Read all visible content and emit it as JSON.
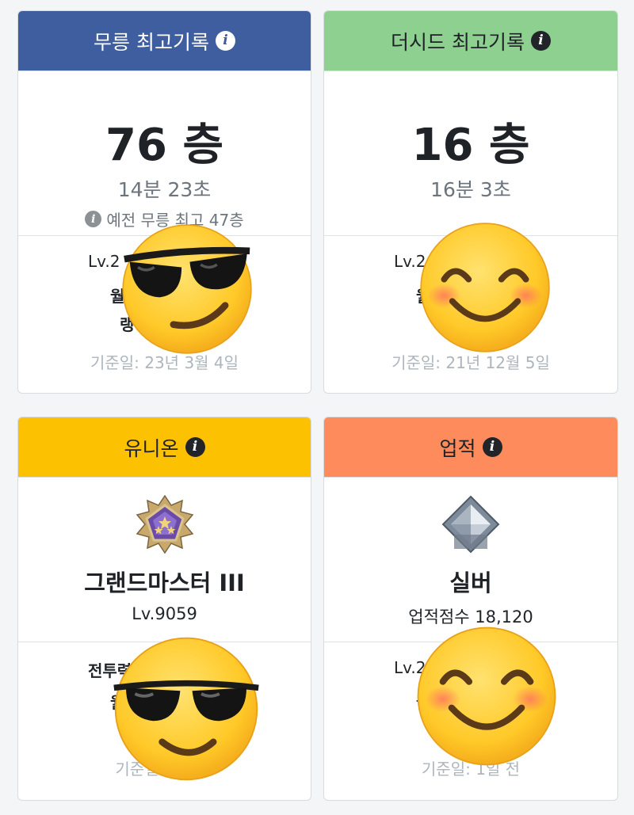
{
  "cards": {
    "mureung": {
      "header": "무릉 최고기록",
      "header_color": "#3f5ea0",
      "floor": "76 층",
      "time": "14분 23초",
      "previous": "예전 무릉 최고 47층",
      "char_level_partial": "Lv.2",
      "char_line2_partial": "월",
      "char_line3_partial": "랭",
      "basis_date": "기준일: 23년 3월 4일"
    },
    "theseed": {
      "header": "더시드 최고기록",
      "header_color": "#8dd08f",
      "floor": "16 층",
      "time": "16분 3초",
      "char_level_partial": "Lv.2",
      "char_line2_partial": "월",
      "basis_date": "기준일: 21년 12월 5일"
    },
    "union": {
      "header": "유니온",
      "header_color": "#fcc100",
      "rank_name": "그랜드마스터 III",
      "level": "Lv.9059",
      "bottom_line1_partial": "전투력",
      "bottom_line2_partial": "월",
      "basis_date": "기준일: 1일 전"
    },
    "achievement": {
      "header": "업적",
      "header_color": "#fd8b5c",
      "rank_name": "실버",
      "score": "업적점수 18,120",
      "char_level_partial": "Lv.2",
      "char_line2_partial": "월",
      "basis_date": "기준일: 1일 전"
    }
  },
  "icons": {
    "info": "info-circle-icon",
    "emoji_cool": "sunglasses-emoji",
    "emoji_smile": "smiling-blush-emoji"
  }
}
